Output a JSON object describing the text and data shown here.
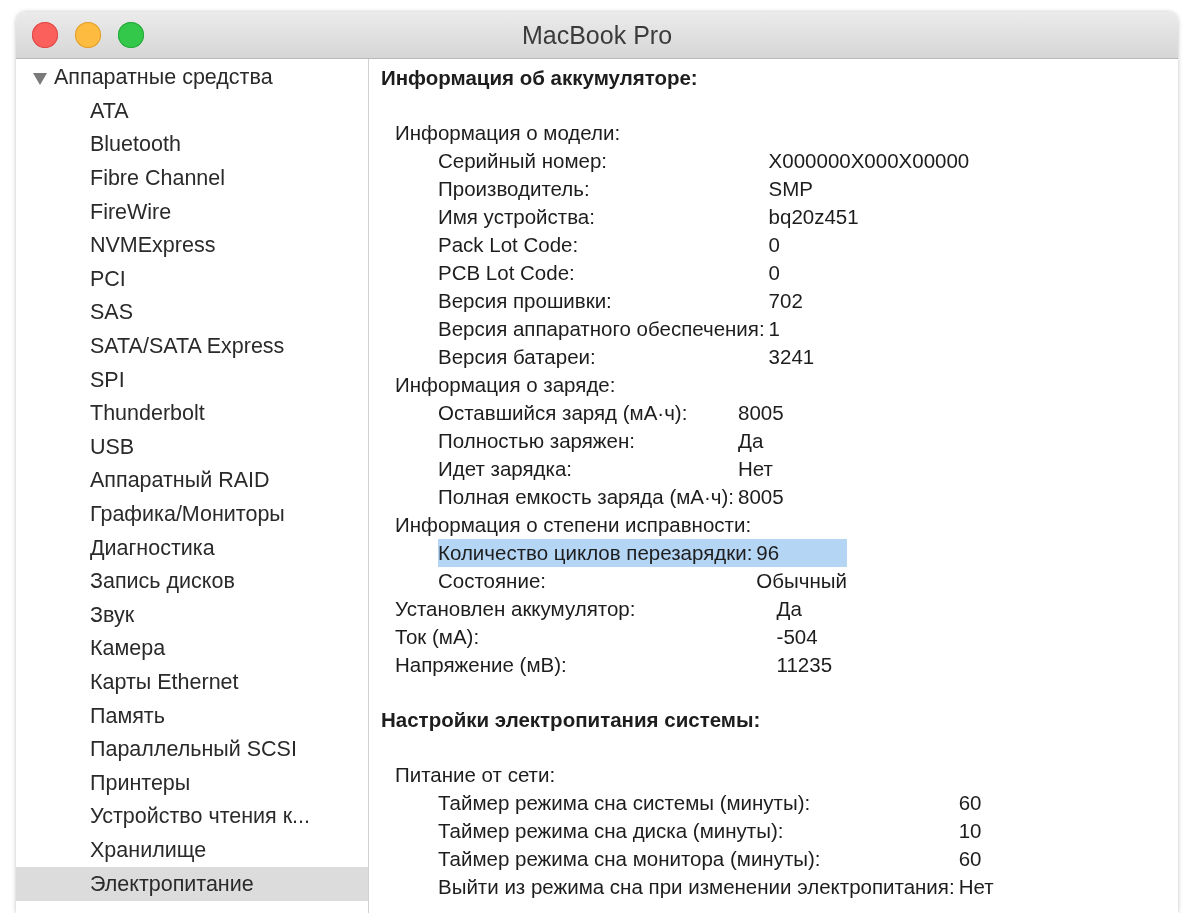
{
  "window": {
    "title": "MacBook Pro"
  },
  "sidebar": {
    "items": [
      {
        "label": "Аппаратные средства",
        "expanded": true,
        "selected": false,
        "children": [
          {
            "label": "ATA",
            "selected": false
          },
          {
            "label": "Bluetooth",
            "selected": false
          },
          {
            "label": "Fibre Channel",
            "selected": false
          },
          {
            "label": "FireWire",
            "selected": false
          },
          {
            "label": "NVMExpress",
            "selected": false
          },
          {
            "label": "PCI",
            "selected": false
          },
          {
            "label": "SAS",
            "selected": false
          },
          {
            "label": "SATA/SATA Express",
            "selected": false
          },
          {
            "label": "SPI",
            "selected": false
          },
          {
            "label": "Thunderbolt",
            "selected": false
          },
          {
            "label": "USB",
            "selected": false
          },
          {
            "label": "Аппаратный RAID",
            "selected": false
          },
          {
            "label": "Графика/Мониторы",
            "selected": false
          },
          {
            "label": "Диагностика",
            "selected": false
          },
          {
            "label": "Запись дисков",
            "selected": false
          },
          {
            "label": "Звук",
            "selected": false
          },
          {
            "label": "Камера",
            "selected": false
          },
          {
            "label": "Карты Ethernet",
            "selected": false
          },
          {
            "label": "Память",
            "selected": false
          },
          {
            "label": "Параллельный SCSI",
            "selected": false
          },
          {
            "label": "Принтеры",
            "selected": false
          },
          {
            "label": "Устройство чтения к...",
            "selected": false
          },
          {
            "label": "Хранилище",
            "selected": false
          },
          {
            "label": "Электропитание",
            "selected": true
          }
        ]
      }
    ]
  },
  "content": {
    "sections": [
      {
        "title": "Информация об аккумуляторе:",
        "items": [
          {
            "label": "Информация о модели:",
            "selected": false,
            "children": [
              {
                "label": "Серийный номер:",
                "value": "X000000X000X00000",
                "selected": false
              },
              {
                "label": "Производитель:",
                "value": "SMP",
                "selected": false
              },
              {
                "label": "Имя устройства:",
                "value": "bq20z451",
                "selected": false
              },
              {
                "label": "Pack Lot Code:",
                "value": "0",
                "selected": false
              },
              {
                "label": "PCB Lot Code:",
                "value": "0",
                "selected": false
              },
              {
                "label": "Версия прошивки:",
                "value": "702",
                "selected": false
              },
              {
                "label": "Версия аппаратного обеспечения:",
                "value": "1",
                "selected": false
              },
              {
                "label": "Версия батареи:",
                "value": "3241",
                "selected": false
              }
            ]
          },
          {
            "label": "Информация о заряде:",
            "selected": false,
            "children": [
              {
                "label": "Оставшийся заряд (мА·ч):",
                "value": "8005",
                "selected": false
              },
              {
                "label": "Полностью заряжен:",
                "value": "Да",
                "selected": false
              },
              {
                "label": "Идет зарядка:",
                "value": "Нет",
                "selected": false
              },
              {
                "label": "Полная емкость заряда (мА·ч):",
                "value": "8005",
                "selected": false
              }
            ]
          },
          {
            "label": "Информация о степени исправности:",
            "selected": false,
            "children": [
              {
                "label": "Количество циклов перезарядки:",
                "value": "96",
                "selected": true
              },
              {
                "label": "Состояние:",
                "value": "Обычный",
                "selected": false
              }
            ]
          },
          {
            "label": "Установлен аккумулятор:",
            "value": "Да",
            "selected": false
          },
          {
            "label": "Ток (мА):",
            "value": "-504",
            "selected": false
          },
          {
            "label": "Напряжение (мВ):",
            "value": "11235",
            "selected": false
          }
        ]
      },
      {
        "title": "Настройки электропитания системы:",
        "items": [
          {
            "label": "Питание от сети:",
            "selected": false,
            "children": [
              {
                "label": "Таймер режима сна системы (минуты):",
                "value": "60",
                "selected": false
              },
              {
                "label": "Таймер режима сна диска (минуты):",
                "value": "10",
                "selected": false
              },
              {
                "label": "Таймер режима сна монитора (минуты):",
                "value": "60",
                "selected": false
              },
              {
                "label": "Выйти из режима сна при изменении электропитания:",
                "value": "Нет",
                "selected": false
              }
            ]
          }
        ]
      }
    ]
  }
}
